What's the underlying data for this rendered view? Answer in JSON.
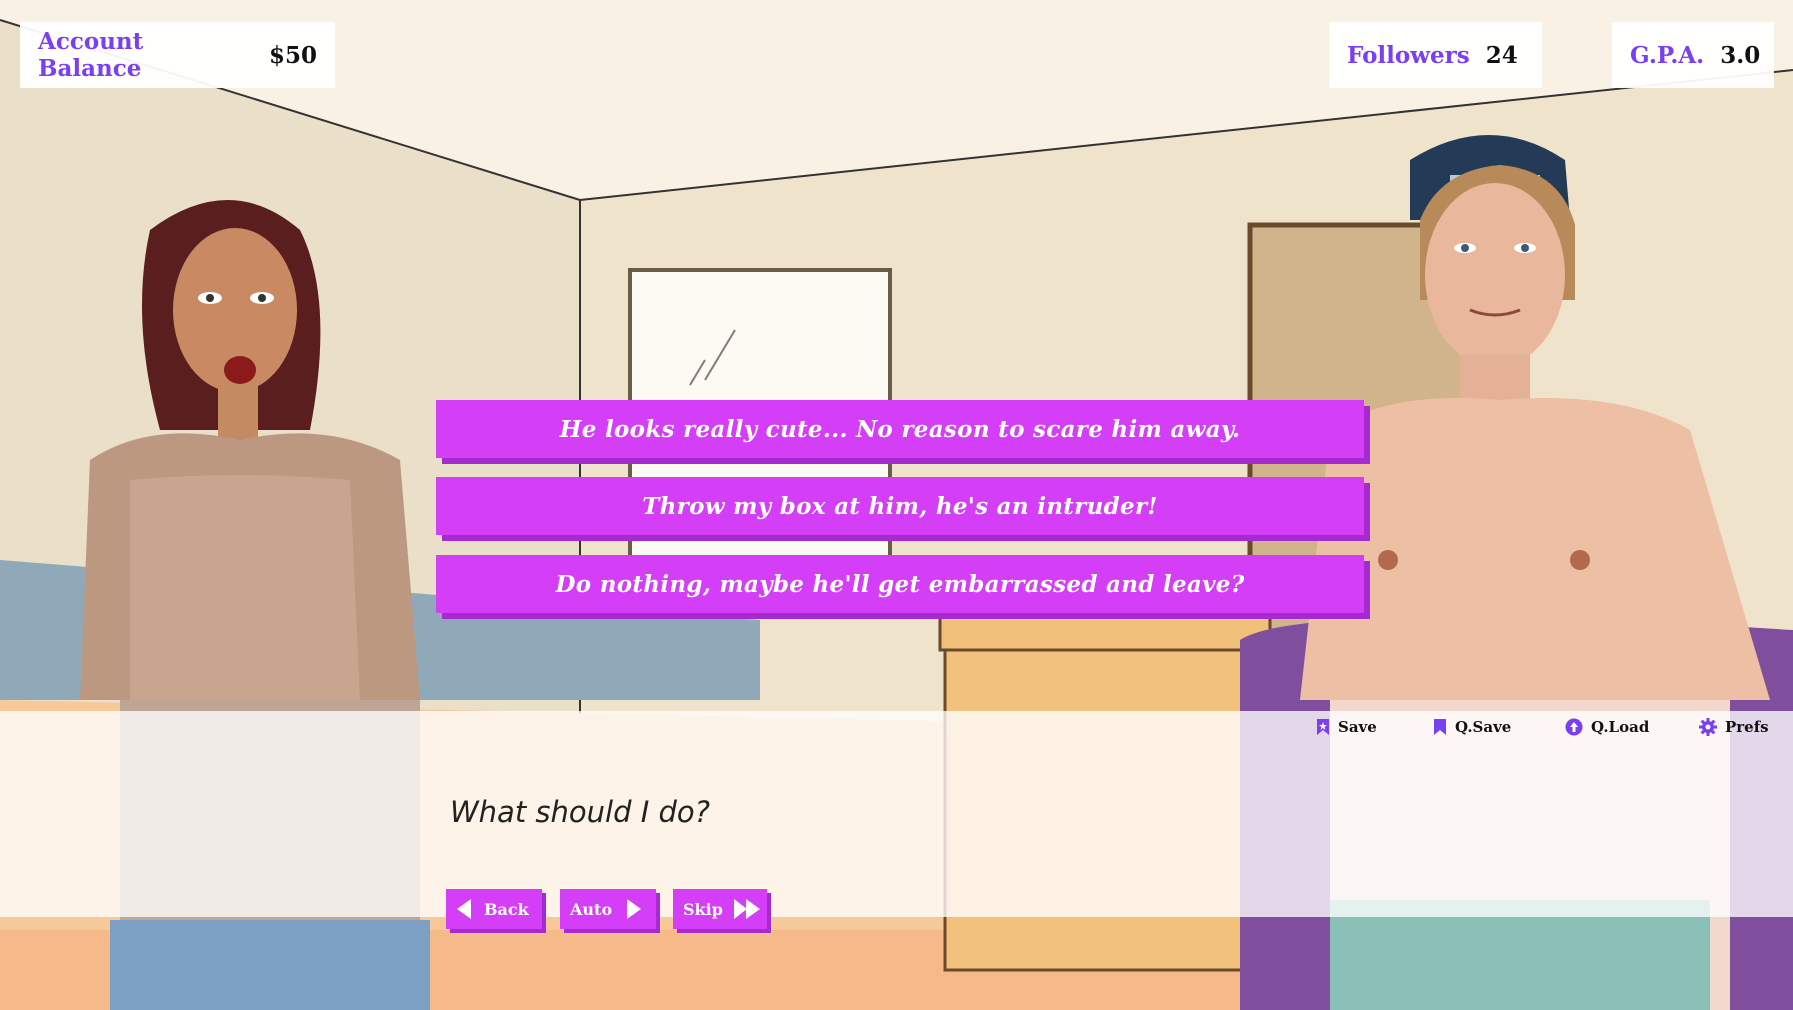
{
  "hud": {
    "balance": {
      "label": "Account Balance",
      "value": "$50"
    },
    "followers": {
      "label": "Followers",
      "value": "24"
    },
    "gpa": {
      "label": "G.P.A.",
      "value": "3.0"
    }
  },
  "choices": [
    "He looks really cute... No reason to scare him away.",
    "Throw my box at him, he's an intruder!",
    "Do nothing, maybe he'll get embarrassed and leave?"
  ],
  "dialogue": {
    "text": "What should I do?"
  },
  "quick_menu": {
    "save": "Save",
    "qsave": "Q.Save",
    "qload": "Q.Load",
    "prefs": "Prefs"
  },
  "controls": {
    "back": "Back",
    "auto": "Auto",
    "skip": "Skip"
  },
  "colors": {
    "accent": "#d43ef6",
    "accent_shadow": "#a52bd0",
    "label": "#7b3ff2"
  }
}
